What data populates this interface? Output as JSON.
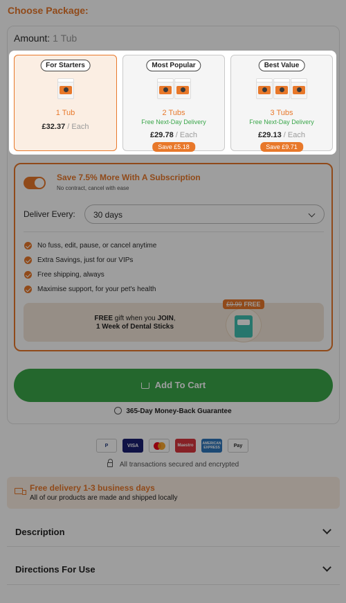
{
  "header": {
    "title": "Choose Package:"
  },
  "amount": {
    "label": "Amount:",
    "value": "1 Tub"
  },
  "packages": [
    {
      "badge": "For Starters",
      "name": "1 Tub",
      "delivery": "",
      "price": "£32.37",
      "each": "/ Each",
      "save": "",
      "selected": true,
      "tubs": 1
    },
    {
      "badge": "Most Popular",
      "name": "2 Tubs",
      "delivery": "Free Next-Day Delivery",
      "price": "£29.78",
      "each": "/ Each",
      "save": "Save £5.18",
      "selected": false,
      "tubs": 2
    },
    {
      "badge": "Best Value",
      "name": "3 Tubs",
      "delivery": "Free Next-Day Delivery",
      "price": "£29.13",
      "each": "/ Each",
      "save": "Save £9.71",
      "selected": false,
      "tubs": 3
    }
  ],
  "subscription": {
    "toggle_on": true,
    "title": "Save 7.5% More With A Subscription",
    "note": "No contract, cancel with ease",
    "deliver_label": "Deliver Every:",
    "deliver_value": "30 days",
    "benefits": [
      "No fuss, edit, pause, or cancel anytime",
      "Extra Savings, just for our VIPs",
      "Free shipping, always",
      "Maximise support, for your pet's health"
    ],
    "gift": {
      "free_word": "FREE",
      "line1_rest": " gift when you ",
      "join_word": "JOIN",
      "line1_end": ",",
      "line2": "1 Week of Dental Sticks",
      "old_price": "£9.99",
      "badge_free": "FREE"
    }
  },
  "cart": {
    "label": "Add To Cart"
  },
  "guarantee": {
    "text": "365-Day Money-Back Guarantee"
  },
  "payments": [
    {
      "icon": "paypal-icon",
      "text": "P"
    },
    {
      "icon": "visa-icon",
      "text": "VISA"
    },
    {
      "icon": "mastercard-icon",
      "text": ""
    },
    {
      "icon": "maestro-icon",
      "text": "Maestro"
    },
    {
      "icon": "amex-icon",
      "text": "AMERICAN EXPRESS"
    },
    {
      "icon": "apple-pay-icon",
      "text": "Pay"
    }
  ],
  "secured": {
    "text": "All transactions secured and encrypted"
  },
  "delivery_banner": {
    "title": "Free delivery 1-3 business days",
    "subtitle": "All of our products are made and shipped locally"
  },
  "accordions": [
    {
      "title": "Description"
    },
    {
      "title": "Directions For Use"
    }
  ],
  "colors": {
    "accent": "#e8782a",
    "green": "#3aa64a",
    "selected_bg": "#fbeee3"
  }
}
